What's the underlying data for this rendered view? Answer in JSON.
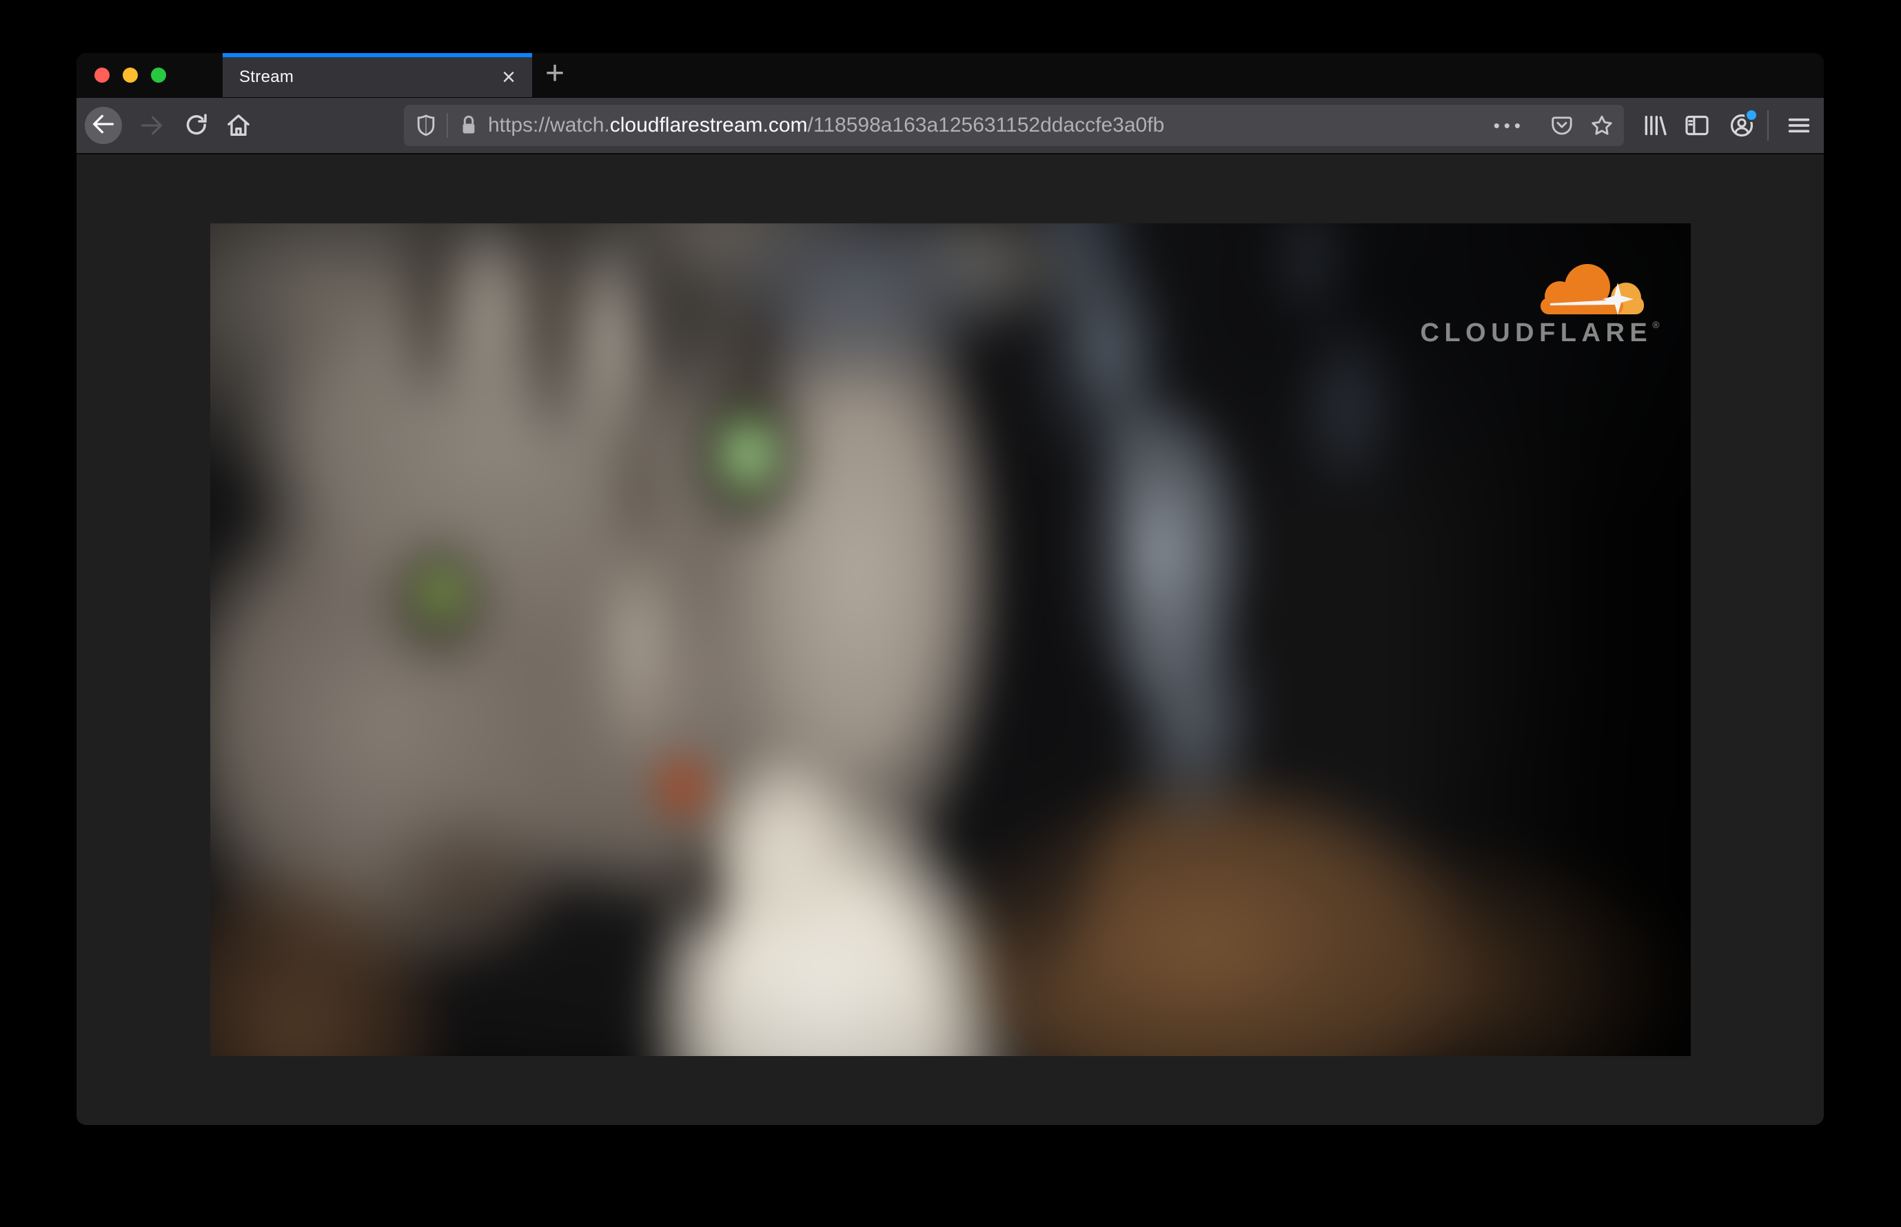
{
  "window_title_bar": {
    "traffic_lights": [
      {
        "name": "close",
        "color": "#ff5f57"
      },
      {
        "name": "minimize",
        "color": "#febc2e"
      },
      {
        "name": "zoom",
        "color": "#28c840"
      }
    ]
  },
  "tab_bar": {
    "active_tab": {
      "title": "Stream",
      "close_glyph": "×"
    },
    "new_tab_glyph": "+",
    "accent_color": "#0a84ff"
  },
  "toolbar": {
    "url": {
      "prefix": "https://watch.",
      "domain": "cloudflarestream.com",
      "path": "/118598a163a125631152ddaccfe3a0fb"
    },
    "page_actions_glyph": "•••"
  },
  "video": {
    "watermark": {
      "wordmark": "CLOUDFLARE",
      "reg": "®",
      "cloud_orange": "#f6821f",
      "cloud_orange_light": "#fbad41"
    }
  }
}
